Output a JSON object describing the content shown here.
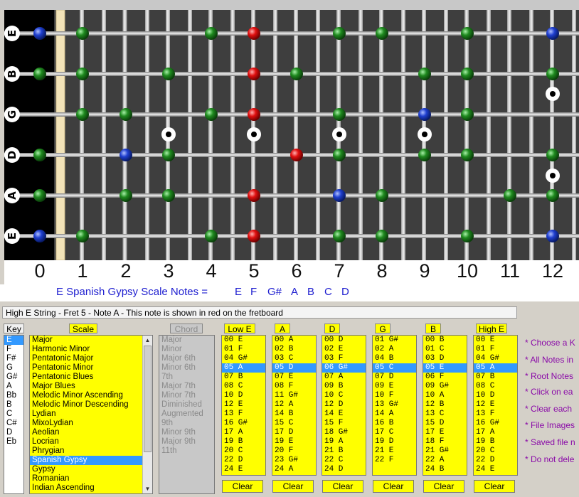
{
  "fretboard": {
    "strings": [
      "E",
      "B",
      "G",
      "D",
      "A",
      "E"
    ],
    "fret_numbers": [
      "0",
      "1",
      "2",
      "3",
      "4",
      "5",
      "6",
      "7",
      "8",
      "9",
      "10",
      "11",
      "12"
    ],
    "inlay_frets": [
      3,
      5,
      7,
      9,
      12
    ],
    "marker_colors": {
      "green": "#1f8a1f",
      "red": "#e01010",
      "blue": "#1f3fcf"
    },
    "markers": [
      {
        "string": 0,
        "fret": 0,
        "color": "blue"
      },
      {
        "string": 0,
        "fret": 1,
        "color": "green"
      },
      {
        "string": 0,
        "fret": 4,
        "color": "green"
      },
      {
        "string": 0,
        "fret": 5,
        "color": "red"
      },
      {
        "string": 0,
        "fret": 7,
        "color": "green"
      },
      {
        "string": 0,
        "fret": 8,
        "color": "green"
      },
      {
        "string": 0,
        "fret": 10,
        "color": "green"
      },
      {
        "string": 0,
        "fret": 12,
        "color": "blue"
      },
      {
        "string": 1,
        "fret": 0,
        "color": "green"
      },
      {
        "string": 1,
        "fret": 1,
        "color": "green"
      },
      {
        "string": 1,
        "fret": 3,
        "color": "green"
      },
      {
        "string": 1,
        "fret": 5,
        "color": "red"
      },
      {
        "string": 1,
        "fret": 6,
        "color": "green"
      },
      {
        "string": 1,
        "fret": 9,
        "color": "green"
      },
      {
        "string": 1,
        "fret": 10,
        "color": "green"
      },
      {
        "string": 1,
        "fret": 12,
        "color": "green"
      },
      {
        "string": 2,
        "fret": 1,
        "color": "green"
      },
      {
        "string": 2,
        "fret": 2,
        "color": "green"
      },
      {
        "string": 2,
        "fret": 4,
        "color": "green"
      },
      {
        "string": 2,
        "fret": 5,
        "color": "red"
      },
      {
        "string": 2,
        "fret": 7,
        "color": "green"
      },
      {
        "string": 2,
        "fret": 9,
        "color": "blue"
      },
      {
        "string": 2,
        "fret": 10,
        "color": "green"
      },
      {
        "string": 3,
        "fret": 0,
        "color": "green"
      },
      {
        "string": 3,
        "fret": 2,
        "color": "blue"
      },
      {
        "string": 3,
        "fret": 3,
        "color": "green"
      },
      {
        "string": 3,
        "fret": 6,
        "color": "red"
      },
      {
        "string": 3,
        "fret": 7,
        "color": "green"
      },
      {
        "string": 3,
        "fret": 9,
        "color": "green"
      },
      {
        "string": 3,
        "fret": 10,
        "color": "green"
      },
      {
        "string": 3,
        "fret": 12,
        "color": "green"
      },
      {
        "string": 4,
        "fret": 0,
        "color": "green"
      },
      {
        "string": 4,
        "fret": 2,
        "color": "green"
      },
      {
        "string": 4,
        "fret": 3,
        "color": "green"
      },
      {
        "string": 4,
        "fret": 5,
        "color": "red"
      },
      {
        "string": 4,
        "fret": 7,
        "color": "blue"
      },
      {
        "string": 4,
        "fret": 8,
        "color": "green"
      },
      {
        "string": 4,
        "fret": 11,
        "color": "green"
      },
      {
        "string": 4,
        "fret": 12,
        "color": "green"
      },
      {
        "string": 5,
        "fret": 0,
        "color": "blue"
      },
      {
        "string": 5,
        "fret": 1,
        "color": "green"
      },
      {
        "string": 5,
        "fret": 4,
        "color": "green"
      },
      {
        "string": 5,
        "fret": 5,
        "color": "red"
      },
      {
        "string": 5,
        "fret": 7,
        "color": "green"
      },
      {
        "string": 5,
        "fret": 8,
        "color": "green"
      },
      {
        "string": 5,
        "fret": 10,
        "color": "green"
      },
      {
        "string": 5,
        "fret": 12,
        "color": "blue"
      }
    ]
  },
  "scale_notes": {
    "title": "E Spanish Gypsy Scale Notes  =",
    "notes": [
      "E",
      "F",
      "G#",
      "A",
      "B",
      "C",
      "D"
    ]
  },
  "status": "High E String - Fret 5 - Note  A - This note is shown in red on the fretboard",
  "key": {
    "label": "Key",
    "items": [
      "E",
      "F",
      "F#",
      "G",
      "G#",
      "A",
      "Bb",
      "B",
      "C",
      "C#",
      "D",
      "Eb"
    ],
    "selected": 0
  },
  "scale": {
    "label": "Scale",
    "items": [
      "Major",
      "Harmonic Minor",
      "Pentatonic Major",
      "Pentatonic Minor",
      "Pentatonic Blues",
      "Major Blues",
      "Melodic Minor Ascending",
      "Melodic Minor Descending",
      "Lydian",
      "MixoLydian",
      "Aeolian",
      "Locrian",
      "Phrygian",
      "Spanish Gypsy",
      "Gypsy",
      "Romanian",
      "Indian Ascending"
    ],
    "selected": 13
  },
  "chord": {
    "label": "Chord",
    "items": [
      "Major",
      "Minor",
      "Major 6th",
      "Minor 6th",
      "7th",
      "Major 7th",
      "Minor 7th",
      "Diminished",
      "Augmented",
      "9th",
      "Minor 9th",
      "Major 9th",
      "11th"
    ]
  },
  "string_columns": [
    {
      "label": "Low E",
      "items": [
        "00  E",
        "01  F",
        "04  G#",
        "05  A",
        "07  B",
        "08  C",
        "10  D",
        "12  E",
        "13  F",
        "16  G#",
        "17  A",
        "19  B",
        "20  C",
        "22  D",
        "24  E"
      ],
      "selected": 3
    },
    {
      "label": "A",
      "items": [
        "00  A",
        "02  B",
        "03  C",
        "05  D",
        "07  E",
        "08  F",
        "11  G#",
        "12  A",
        "14  B",
        "15  C",
        "17  D",
        "19  E",
        "20  F",
        "23  G#",
        "24  A"
      ],
      "selected": 3
    },
    {
      "label": "D",
      "items": [
        "00  D",
        "02  E",
        "03  F",
        "06  G#",
        "07  A",
        "09  B",
        "10  C",
        "12  D",
        "14  E",
        "15  F",
        "18  G#",
        "19  A",
        "21  B",
        "22  C",
        "24  D"
      ],
      "selected": 3
    },
    {
      "label": "G",
      "items": [
        "01  G#",
        "02  A",
        "04  B",
        "05  C",
        "07  D",
        "09  E",
        "10  F",
        "13  G#",
        "14  A",
        "16  B",
        "17  C",
        "19  D",
        "21  E",
        "22  F"
      ],
      "selected": 3
    },
    {
      "label": "B",
      "items": [
        "00  B",
        "01  C",
        "03  D",
        "05  E",
        "06  F",
        "09  G#",
        "10  A",
        "12  B",
        "13  C",
        "15  D",
        "17  E",
        "18  F",
        "21  G#",
        "22  A",
        "24  B"
      ],
      "selected": 3
    },
    {
      "label": "High E",
      "items": [
        "00  E",
        "01  F",
        "04  G#",
        "05  A",
        "07  B",
        "08  C",
        "10  D",
        "12  E",
        "13  F",
        "16  G#",
        "17  A",
        "19  B",
        "20  C",
        "22  D",
        "24  E"
      ],
      "selected": 3
    }
  ],
  "clear_label": "Clear",
  "help_lines": [
    "* Choose a K",
    "* All Notes in",
    "* Root Notes",
    "* Click on ea",
    "* Clear each",
    "* File Images",
    "* Saved file n",
    "* Do not dele"
  ]
}
